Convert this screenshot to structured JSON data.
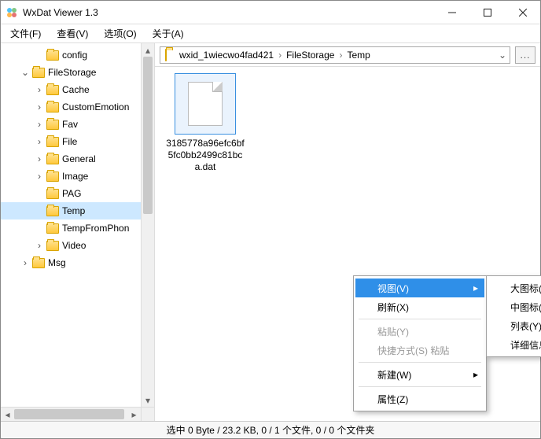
{
  "window": {
    "title": "WxDat Viewer 1.3"
  },
  "menubar": {
    "items": [
      "文件(F)",
      "查看(V)",
      "选项(O)",
      "关于(A)"
    ]
  },
  "sidebar": {
    "items": [
      {
        "indent": 2,
        "twisty": "",
        "label": "config"
      },
      {
        "indent": 1,
        "twisty": "⌄",
        "label": "FileStorage"
      },
      {
        "indent": 2,
        "twisty": "›",
        "label": "Cache"
      },
      {
        "indent": 2,
        "twisty": "›",
        "label": "CustomEmotion"
      },
      {
        "indent": 2,
        "twisty": "›",
        "label": "Fav"
      },
      {
        "indent": 2,
        "twisty": "›",
        "label": "File"
      },
      {
        "indent": 2,
        "twisty": "›",
        "label": "General"
      },
      {
        "indent": 2,
        "twisty": "›",
        "label": "Image"
      },
      {
        "indent": 2,
        "twisty": "",
        "label": "PAG"
      },
      {
        "indent": 2,
        "twisty": "",
        "label": "Temp",
        "selected": true
      },
      {
        "indent": 2,
        "twisty": "",
        "label": "TempFromPhon"
      },
      {
        "indent": 2,
        "twisty": "›",
        "label": "Video"
      },
      {
        "indent": 1,
        "twisty": "›",
        "label": "Msg"
      }
    ]
  },
  "address": {
    "crumbs": [
      "wxid_1wiecwo4fad421",
      "FileStorage",
      "Temp"
    ],
    "ext_label": "..."
  },
  "content": {
    "file_name": "3185778a96efc6bf5fc0bb2499c81bca.dat"
  },
  "context_menu": {
    "main": [
      {
        "label": "视图(V)",
        "hl": true,
        "submenu": true
      },
      {
        "label": "刷新(X)"
      },
      {
        "sep": true
      },
      {
        "label": "粘贴(Y)",
        "disabled": true
      },
      {
        "label": "快捷方式(S) 粘贴",
        "disabled": true
      },
      {
        "sep": true
      },
      {
        "label": "新建(W)",
        "submenu": true
      },
      {
        "sep": true
      },
      {
        "label": "属性(Z)"
      }
    ],
    "sub": [
      {
        "label": "大图标(W)"
      },
      {
        "label": "中图标(X)"
      },
      {
        "label": "列表(Y)"
      },
      {
        "label": "详细信息(Z)"
      }
    ]
  },
  "statusbar": {
    "text": "选中 0 Byte / 23.2 KB, 0 / 1 个文件, 0 / 0 个文件夹"
  }
}
